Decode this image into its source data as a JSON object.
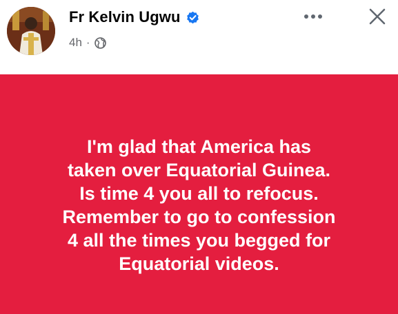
{
  "post": {
    "author_name": "Fr Kelvin Ugwu",
    "timestamp": "4h",
    "separator": "·",
    "privacy_icon": "globe-icon",
    "verified_icon": "verified-badge-icon",
    "more_icon": "more-options-icon",
    "close_icon": "close-icon",
    "content_lines": [
      "I'm glad that America has",
      "taken over Equatorial Guinea.",
      "Is time 4 you all to refocus.",
      "Remember to go to confession",
      "4 all the times you begged for",
      "Equatorial videos."
    ]
  },
  "colors": {
    "background_post": "#e41e3f",
    "verified_blue": "#1877f2",
    "text_primary": "#050505",
    "text_secondary": "#65676b",
    "icon_gray": "#606770"
  }
}
